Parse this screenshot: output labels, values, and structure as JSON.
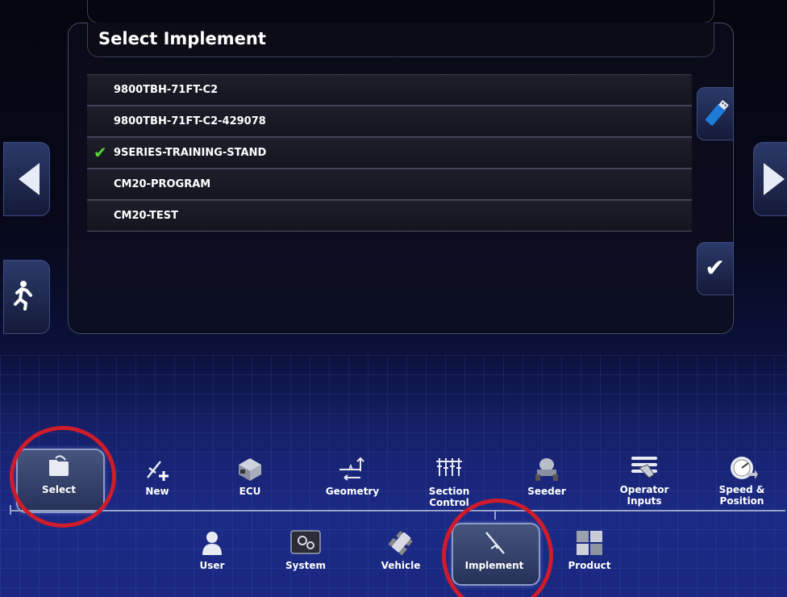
{
  "dialog": {
    "title": "Select Implement",
    "items": [
      {
        "label": "9800TBH-71FT-C2",
        "selected": false
      },
      {
        "label": "9800TBH-71FT-C2-429078",
        "selected": false
      },
      {
        "label": "9SERIES-TRAINING-STAND",
        "selected": true
      },
      {
        "label": "CM20-PROGRAM",
        "selected": false
      },
      {
        "label": "CM20-TEST",
        "selected": false
      }
    ]
  },
  "side_buttons": {
    "usb_icon": "usb-drive-icon",
    "confirm_icon": "checkmark-icon",
    "prev_icon": "arrow-left-icon",
    "next_icon": "arrow-right-icon",
    "exit_icon": "running-man-exit-icon"
  },
  "implement_toolbar": [
    {
      "label": "Select",
      "icon": "folder-select-icon",
      "active": true
    },
    {
      "label": "New",
      "icon": "implement-plus-icon"
    },
    {
      "label": "ECU",
      "icon": "ecu-box-icon"
    },
    {
      "label": "Geometry",
      "icon": "geometry-icon"
    },
    {
      "label": "Section Control",
      "icon": "section-control-icon"
    },
    {
      "label": "Seeder",
      "icon": "seeder-icon"
    },
    {
      "label": "Operator Inputs",
      "icon": "operator-inputs-icon"
    },
    {
      "label": "Speed & Position",
      "icon": "speedometer-icon"
    }
  ],
  "main_toolbar": [
    {
      "label": "User",
      "icon": "user-icon"
    },
    {
      "label": "System",
      "icon": "system-gear-icon"
    },
    {
      "label": "Vehicle",
      "icon": "vehicle-icon"
    },
    {
      "label": "Implement",
      "icon": "implement-icon",
      "active": true
    },
    {
      "label": "Product",
      "icon": "product-icon"
    }
  ],
  "colors": {
    "highlight_ring": "#d01c2a",
    "check": "#5ad23a",
    "accent": "#1b2a85"
  }
}
